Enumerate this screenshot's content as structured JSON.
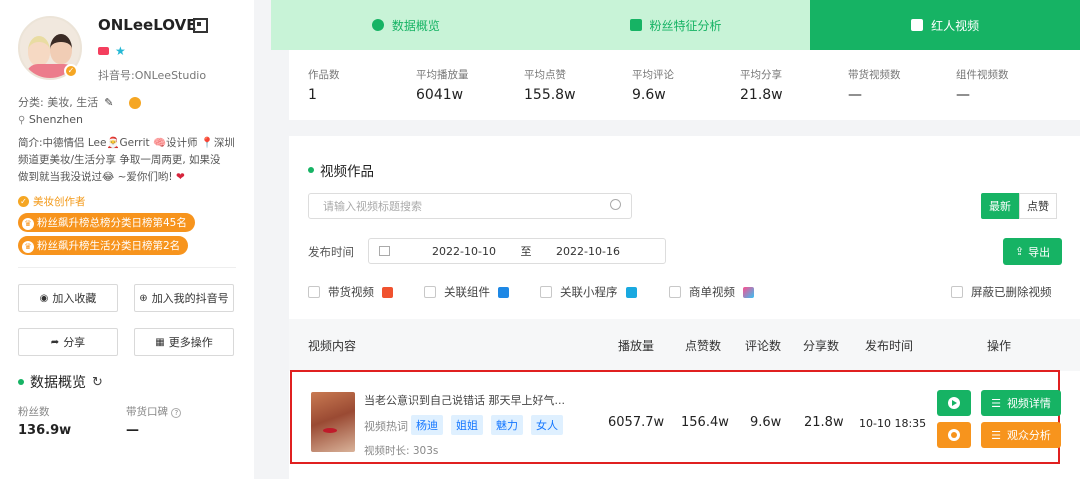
{
  "profile": {
    "nickname": "ONLeeLOVE",
    "douyin_id": "抖音号:ONLeeStudio",
    "category_label": "分类: 美妆, 生活",
    "location": "Shenzhen",
    "bio_line1": "简介:中德情侣 Lee🎅Gerrit 🧠设计师 📍深圳",
    "bio_line2": "频道更美妆/生活分享 争取一周两更, 如果没",
    "bio_line3": "做到就当我没说过😂 ~爱你们哟!",
    "creator_tag": "美妆创作者",
    "rank1": "粉丝飙升榜总榜分类日榜第45名",
    "rank2": "粉丝飙升榜生活分类日榜第2名"
  },
  "sidebar_buttons": {
    "favorite": "加入收藏",
    "add_to_mine": "加入我的抖音号",
    "share": "分享",
    "more": "更多操作"
  },
  "overview": {
    "title": "数据概览",
    "fans_label": "粉丝数",
    "fans_value": "136.9w",
    "reputation_label": "带货口碑",
    "reputation_value": "—"
  },
  "tabs": [
    {
      "label": "数据概览",
      "active": false
    },
    {
      "label": "粉丝特征分析",
      "active": false
    },
    {
      "label": "红人视频",
      "active": true
    }
  ],
  "stats": [
    {
      "label": "作品数",
      "value": "1"
    },
    {
      "label": "平均播放量",
      "value": "6041w"
    },
    {
      "label": "平均点赞",
      "value": "155.8w"
    },
    {
      "label": "平均评论",
      "value": "9.6w"
    },
    {
      "label": "平均分享",
      "value": "21.8w"
    },
    {
      "label": "带货视频数",
      "value": "—"
    },
    {
      "label": "组件视频数",
      "value": "—"
    }
  ],
  "works": {
    "title": "视频作品",
    "search_placeholder": "请输入视频标题搜索",
    "sort_latest": "最新",
    "sort_likes": "点赞",
    "date_label": "发布时间",
    "date_from": "2022-10-10",
    "date_sep": "至",
    "date_to": "2022-10-16",
    "export": "导出",
    "filters": {
      "sales": "带货视频",
      "component": "关联组件",
      "miniapp": "关联小程序",
      "commerce": "商单视频",
      "hide_deleted": "屏蔽已删除视频"
    }
  },
  "table": {
    "headers": {
      "content": "视频内容",
      "plays": "播放量",
      "likes": "点赞数",
      "comments": "评论数",
      "shares": "分享数",
      "publish_time": "发布时间",
      "actions": "操作"
    },
    "rows": [
      {
        "title": "当老公意识到自己说错话 那天早上好气...",
        "hotword_label": "视频热词",
        "hotwords": [
          "杨迪",
          "姐姐",
          "魅力",
          "女人"
        ],
        "duration": "视频时长: 303s",
        "plays": "6057.7w",
        "likes": "156.4w",
        "comments": "9.6w",
        "shares": "21.8w",
        "publish_time": "10-10 18:35",
        "detail_label": "视频详情",
        "audience_label": "观众分析"
      }
    ]
  },
  "colors": {
    "accent": "#16b364",
    "accent_light": "#c8f3d7",
    "orange": "#f7941d",
    "highlight_border": "#e02020"
  }
}
